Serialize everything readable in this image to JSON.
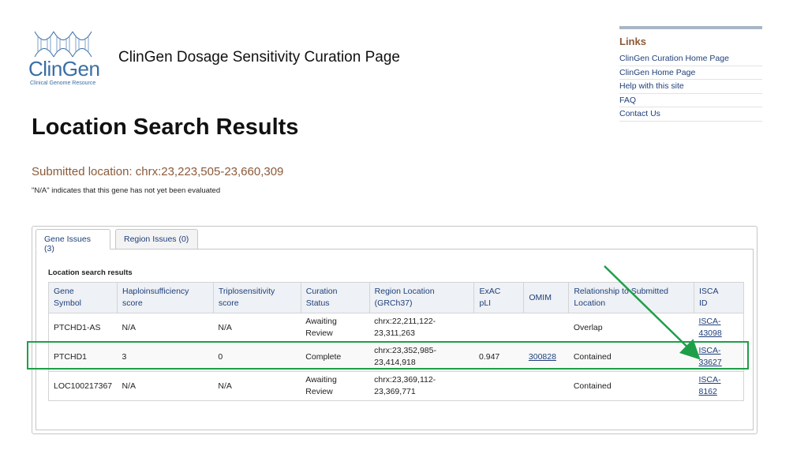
{
  "logo": {
    "word": "ClinGen",
    "subtitle": "Clinical Genome Resource"
  },
  "site_title": "ClinGen Dosage Sensitivity Curation Page",
  "links": {
    "heading": "Links",
    "items": [
      "ClinGen Curation Home Page",
      "ClinGen Home Page",
      "Help with this site",
      "FAQ",
      "Contact Us"
    ]
  },
  "page_heading": "Location Search Results",
  "submitted_location": "Submitted location: chrx:23,223,505-23,660,309",
  "na_note": "\"N/A\" indicates that this gene has not yet been evaluated",
  "tabs": [
    {
      "label": "Gene Issues (3)",
      "active": true
    },
    {
      "label": "Region Issues (0)",
      "active": false
    }
  ],
  "table": {
    "caption": "Location search results",
    "headers": [
      [
        "Gene",
        "Symbol"
      ],
      [
        "Haploinsufficiency",
        "score"
      ],
      [
        "Triplosensitivity",
        "score"
      ],
      [
        "Curation",
        "Status"
      ],
      [
        "Region Location",
        "(GRCh37)"
      ],
      [
        "ExAC",
        "pLI"
      ],
      [
        "OMIM",
        ""
      ],
      [
        "Relationship to Submitted",
        "Location"
      ],
      [
        "ISCA",
        "ID"
      ]
    ],
    "rows": [
      {
        "gene": "PTCHD1-AS",
        "haplo": "N/A",
        "triplo": "N/A",
        "status": [
          "Awaiting",
          "Review"
        ],
        "region": [
          "chrx:22,211,122-",
          "23,311,263"
        ],
        "pli": "",
        "omim": "",
        "relationship": "Overlap",
        "isca": [
          "ISCA-",
          "43098"
        ]
      },
      {
        "gene": "PTCHD1",
        "haplo": "3",
        "triplo": "0",
        "status": [
          "Complete",
          ""
        ],
        "region": [
          "chrx:23,352,985-",
          "23,414,918"
        ],
        "pli": "0.947",
        "omim": "300828",
        "relationship": "Contained",
        "isca": [
          "ISCA-",
          "33627"
        ]
      },
      {
        "gene": "LOC100217367",
        "haplo": "N/A",
        "triplo": "N/A",
        "status": [
          "Awaiting",
          "Review"
        ],
        "region": [
          "chrx:23,369,112-",
          "23,369,771"
        ],
        "pli": "",
        "omim": "",
        "relationship": "Contained",
        "isca": [
          "ISCA-",
          "8162"
        ]
      }
    ]
  },
  "colors": {
    "highlight": "#1f9e4a",
    "link": "#1f3f7a",
    "accent_brown": "#8b5a3a"
  }
}
